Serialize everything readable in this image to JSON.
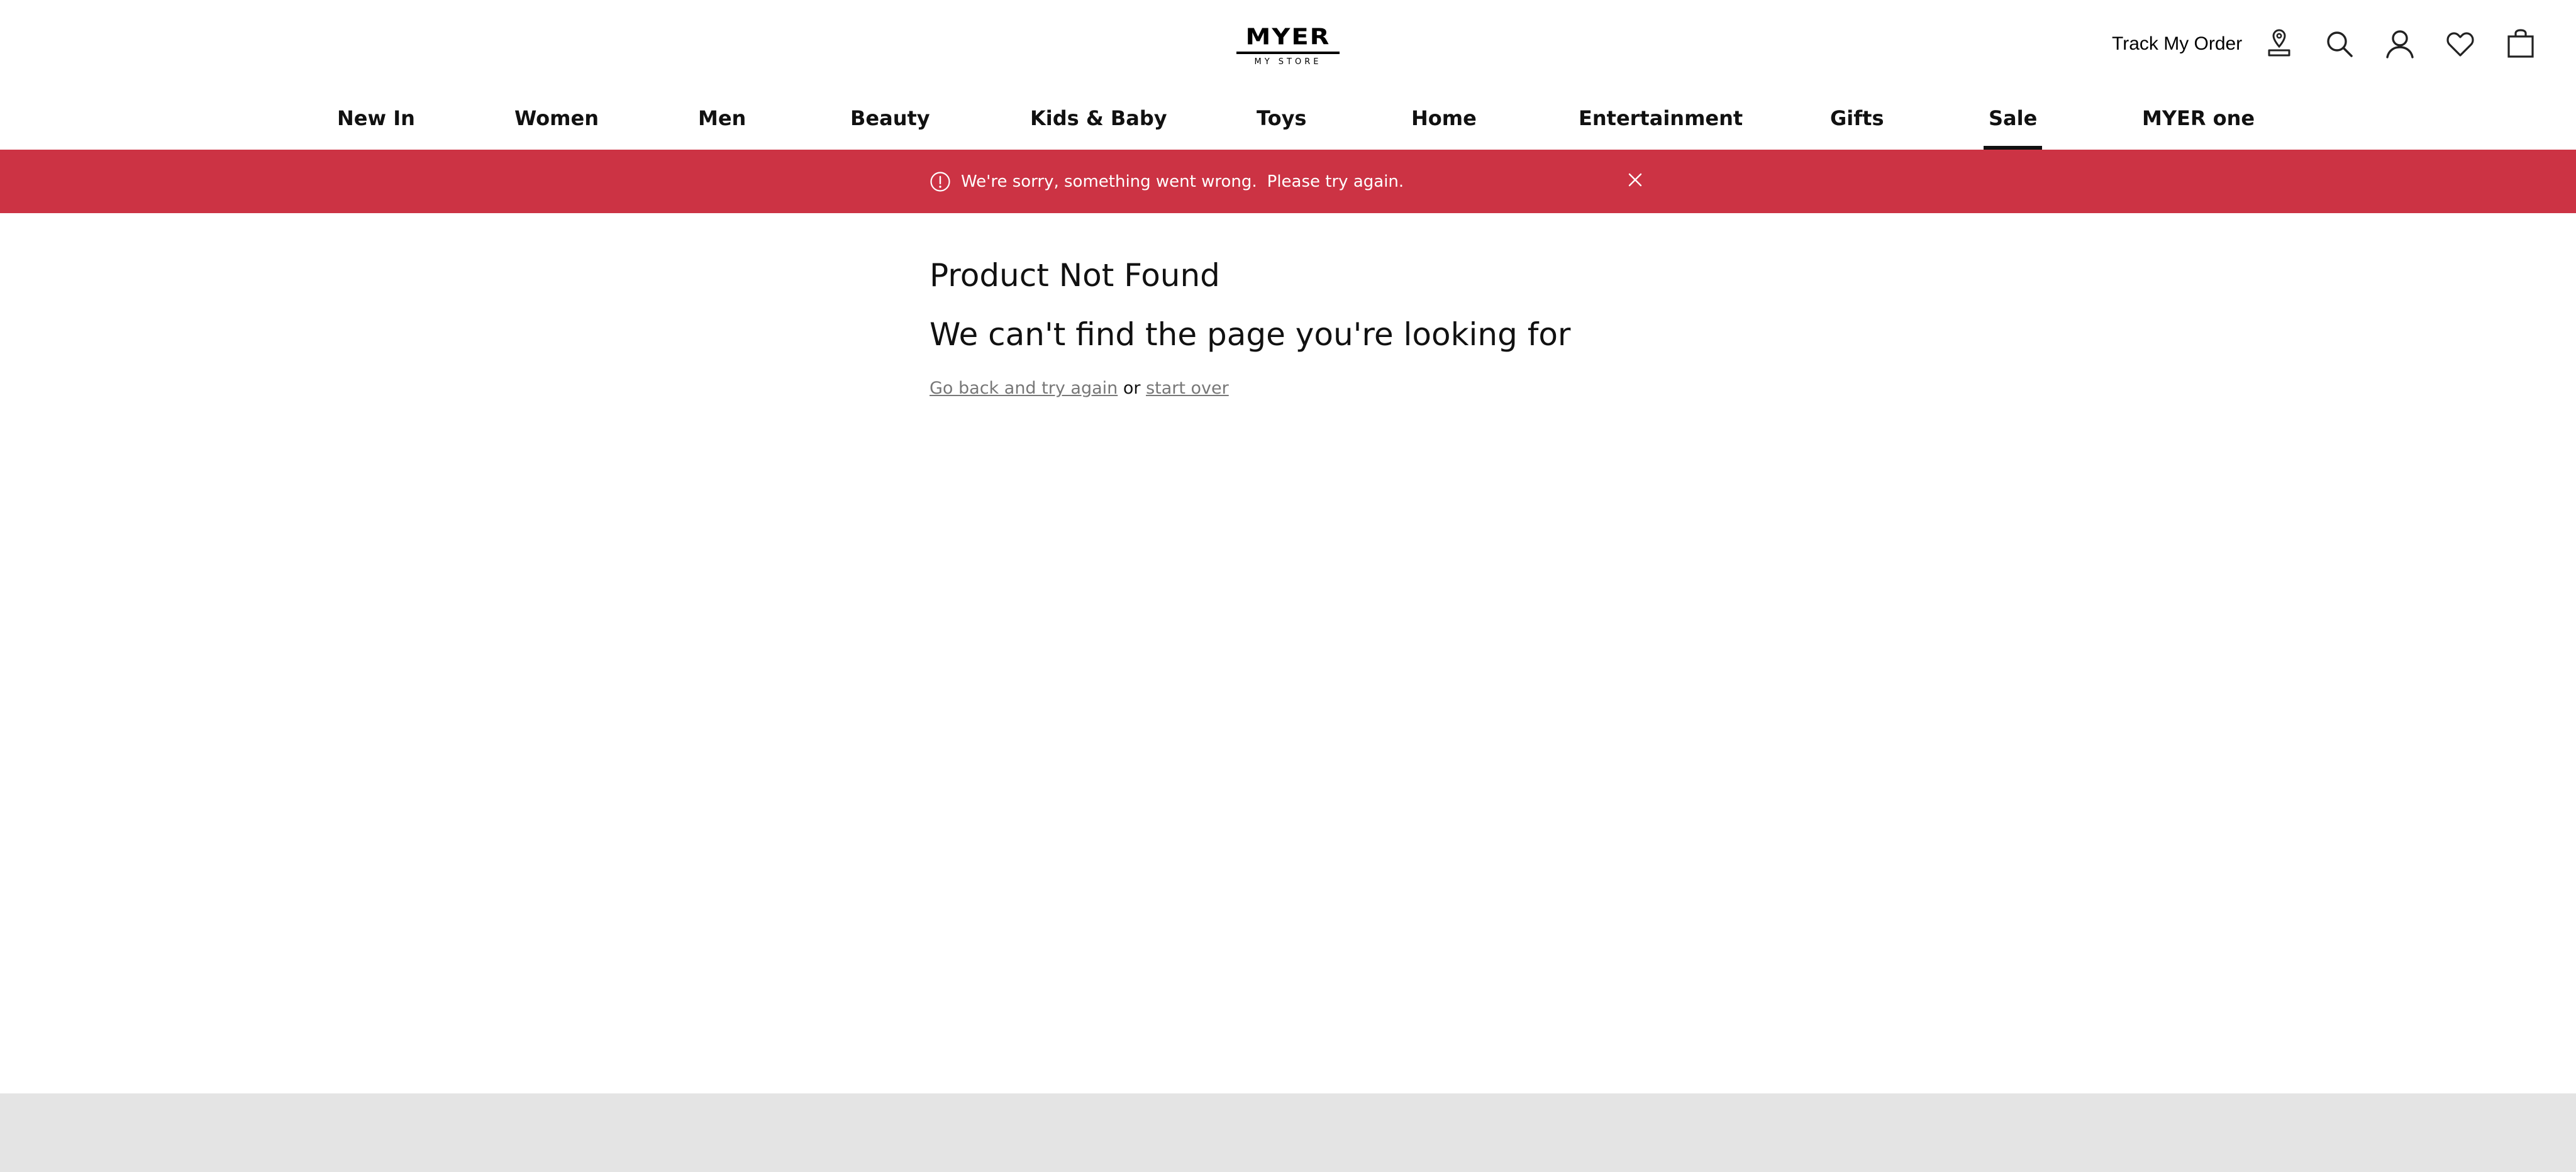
{
  "brand": {
    "logo_text": "MYER",
    "logo_subtext": "MY STORE"
  },
  "utility": {
    "track_order": "Track My Order",
    "icons": [
      "store-locator-icon",
      "search-icon",
      "account-icon",
      "wishlist-heart-icon",
      "shopping-bag-icon"
    ]
  },
  "nav": {
    "items": [
      {
        "label": "New In"
      },
      {
        "label": "Women"
      },
      {
        "label": "Men"
      },
      {
        "label": "Beauty"
      },
      {
        "label": "Kids & Baby"
      },
      {
        "label": "Toys"
      },
      {
        "label": "Home"
      },
      {
        "label": "Entertainment"
      },
      {
        "label": "Gifts"
      },
      {
        "label": "Sale"
      },
      {
        "label": "MYER one"
      }
    ],
    "active": "Sale"
  },
  "banner": {
    "message": "We're sorry, something went wrong.",
    "action": "Please try again.",
    "color": "#cc3344"
  },
  "main": {
    "title": "Product Not Found",
    "subtitle": "We can't find the page you're looking for",
    "link_back": "Go back and try again",
    "or_text": "or",
    "link_start": "start over"
  },
  "colors": {
    "footer_bg": "#e4e4e4",
    "link": "#777777"
  }
}
